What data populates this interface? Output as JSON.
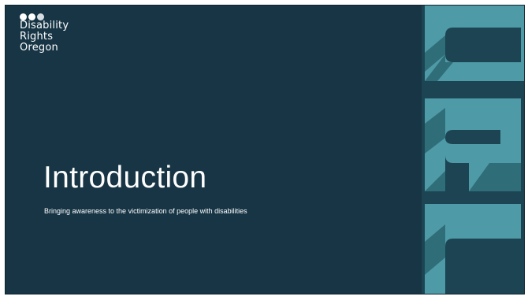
{
  "logo": {
    "line1": "Disability",
    "line2": "Rights",
    "line3": "Oregon"
  },
  "slide": {
    "title": "Introduction",
    "subtitle": "Bringing awareness to the victimization of people with disabilities"
  },
  "colors": {
    "background": "#173545",
    "band": "#1d4453",
    "letter_light": "#4e9aa6",
    "letter_dark": "#2f6e79"
  }
}
